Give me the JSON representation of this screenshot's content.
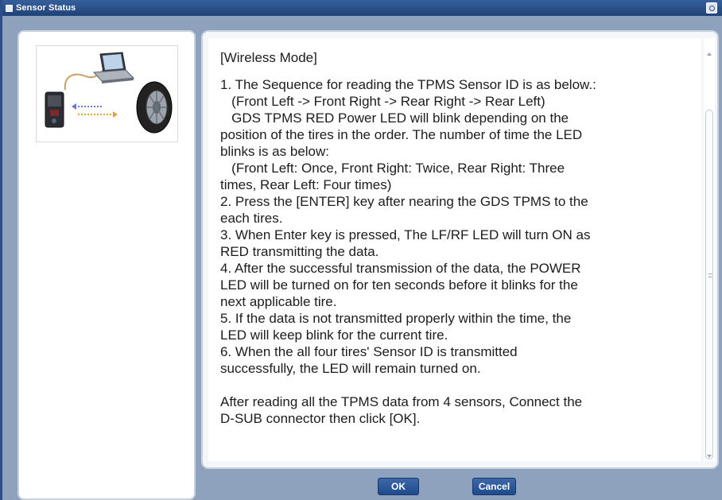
{
  "window": {
    "title": "Sensor Status"
  },
  "illustration": {
    "description_icons": [
      "laptop-icon",
      "scan-tool-icon",
      "tire-icon",
      "usb-cable-icon",
      "wireless-arrow-icon"
    ]
  },
  "content": {
    "mode_title": "[Wireless Mode]",
    "lines": [
      "1. The Sequence for reading the TPMS Sensor ID is as below.:",
      "   (Front Left -> Front Right -> Rear Right -> Rear Left)",
      "   GDS TPMS RED Power LED will blink depending on the",
      "position of the tires in the order. The number of time the LED",
      "blinks is as below:",
      "   (Front Left: Once, Front Right: Twice, Rear Right: Three",
      "times, Rear Left: Four times)",
      "2. Press the [ENTER] key after nearing the GDS TPMS to the",
      "each tires.",
      "3. When Enter key is pressed, The LF/RF LED will turn ON as",
      "RED transmitting the data.",
      "4. After the successful transmission of the data, the POWER",
      "LED will be turned on for ten seconds before it blinks for the",
      "next applicable tire.",
      "5. If the data is not transmitted properly within the time, the",
      "LED will keep blink for the current tire.",
      "6. When the all four tires' Sensor ID is transmitted",
      "successfully, the LED will remain turned on."
    ],
    "closing_lines": [
      "After reading all the TPMS data from 4 sensors, Connect the",
      "D-SUB connector then click [OK]."
    ]
  },
  "buttons": {
    "ok": "OK",
    "cancel": "Cancel"
  },
  "colors": {
    "titlebar": "#1f4377",
    "window_bg": "#8ea2bd",
    "button": "#2b5597",
    "text": "#1c1c1c"
  }
}
